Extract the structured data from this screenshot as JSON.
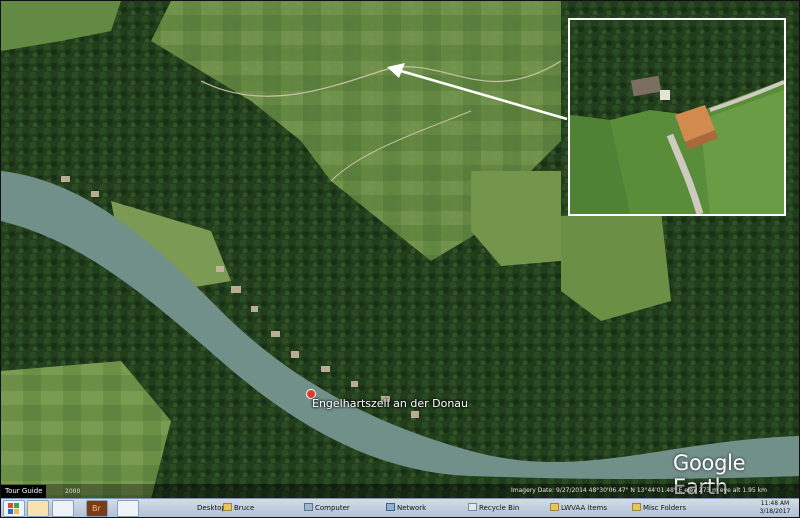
{
  "map": {
    "place_label": "Engelhartszell an der Donau",
    "logo_text": "Google Earth",
    "tour_guide": "Tour Guide",
    "history_year": "2000",
    "status_text": "Imagery Date: 9/27/2014    48°30'06.47\" N  13°44'01.48\" E  elev 273 m   eye alt 1.95 km"
  },
  "taskbar": {
    "items": [
      {
        "label": "Desktop"
      },
      {
        "label": "Bruce"
      },
      {
        "label": "Computer"
      },
      {
        "label": "Network"
      },
      {
        "label": "Recycle Bin"
      },
      {
        "label": "LWVAA items"
      },
      {
        "label": "Misc Folders"
      }
    ],
    "clock_time": "11:48 AM",
    "clock_date": "3/18/2017"
  },
  "colors": {
    "river": "#72908a",
    "forest": "#1f3a1a",
    "field": "#6f9247",
    "inset_border": "#ffffff",
    "pin": "#e23a2c"
  }
}
